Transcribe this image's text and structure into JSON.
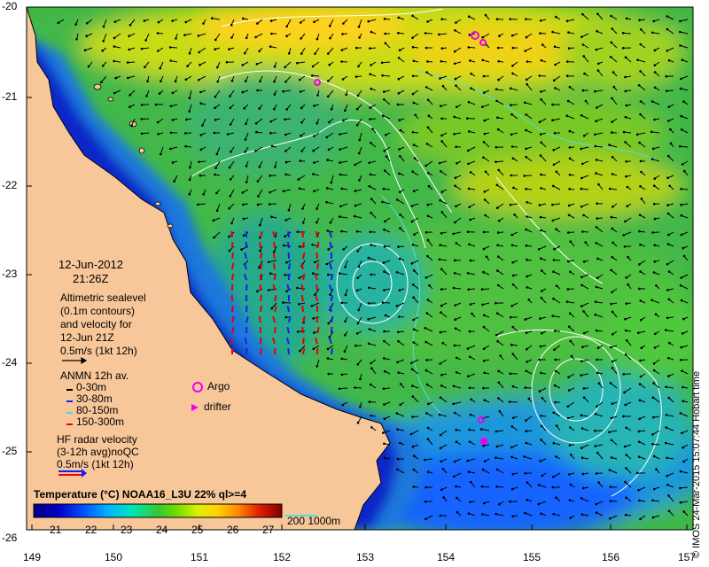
{
  "axes": {
    "lat_labels": [
      "-20",
      "-21",
      "-22",
      "-23",
      "-24",
      "-25",
      "-26"
    ],
    "lon_labels": [
      "149",
      "150",
      "151",
      "152",
      "153",
      "154",
      "155",
      "156",
      "157"
    ]
  },
  "timestamp": {
    "date": "12-Jun-2012",
    "time": "21:26Z"
  },
  "altimetry_legend": {
    "lines": [
      "Altimetric sealevel",
      "(0.1m contours)",
      "and velocity for",
      "12-Jun 21Z"
    ],
    "scale": "0.5m/s (1kt 12h)"
  },
  "anmn_legend": {
    "title": "ANMN 12h av.",
    "items": [
      {
        "label": "0-30m",
        "color": "#000000"
      },
      {
        "label": "30-80m",
        "color": "#1a1aff"
      },
      {
        "label": "80-150m",
        "color": "#33e6e6"
      },
      {
        "label": "150-300m",
        "color": "#e60000"
      }
    ]
  },
  "platforms_legend": {
    "argo": "Argo",
    "drifter": "drifter",
    "color": "#ee00ee"
  },
  "hf_legend": {
    "lines": [
      "HF radar velocity",
      "(3-12h avg)noQC",
      "0.5m/s (1kt 12h)"
    ]
  },
  "colorbar": {
    "title": "Temperature (°C) NOAA16_L3U 22% ql>=4",
    "ticks": [
      "21",
      "22",
      "23",
      "24",
      "25",
      "26",
      "27"
    ],
    "min": 20.5,
    "max": 27.5
  },
  "contour_legend": {
    "label": "200  1000m",
    "color": "#55dddd"
  },
  "credit": "© IMOS 24-Mar-2015 15:07:44 Hobart time",
  "colors": {
    "land": "#f7c79a",
    "coast": "#000000",
    "contour_white": "#ffffff",
    "isobath": "#55dddd"
  }
}
